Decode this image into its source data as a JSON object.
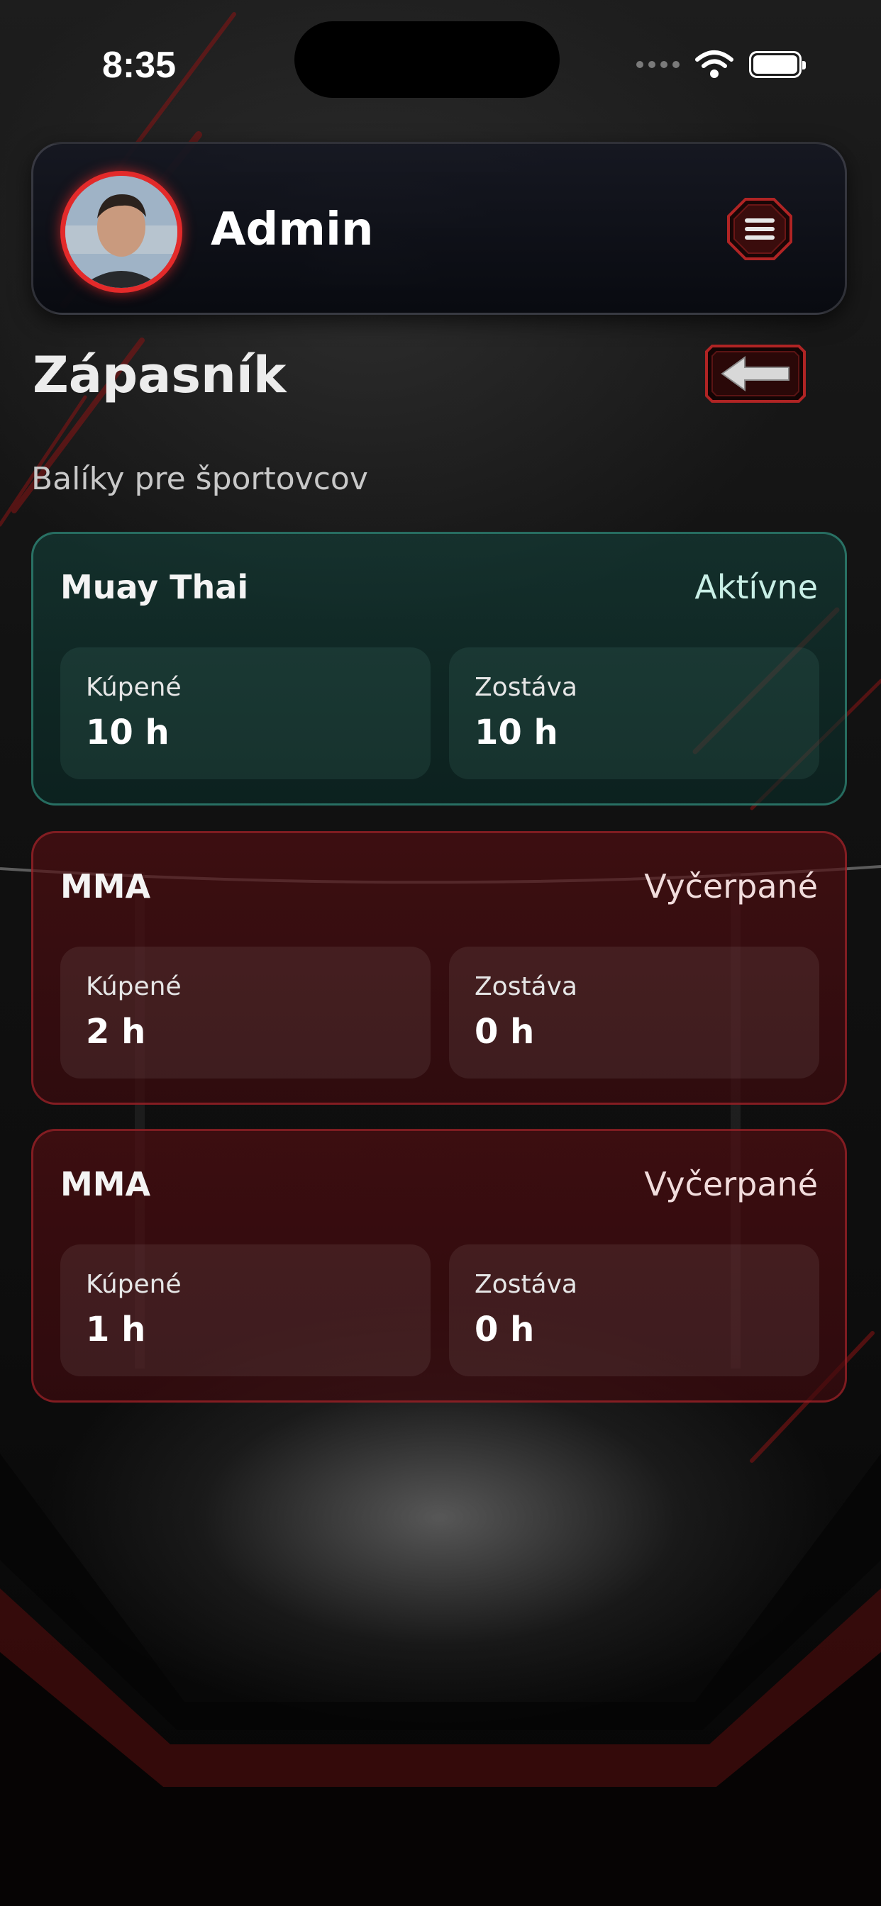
{
  "status_bar": {
    "time": "8:35"
  },
  "header": {
    "username": "Admin"
  },
  "page": {
    "title": "Zápasník",
    "section_label": "Balíky pre športovcov"
  },
  "packages": [
    {
      "name": "Muay Thai",
      "status": "Aktívne",
      "purchased_label": "Kúpené",
      "purchased_value": "10 h",
      "remaining_label": "Zostáva",
      "remaining_value": "10 h"
    },
    {
      "name": "MMA",
      "status": "Vyčerpané",
      "purchased_label": "Kúpené",
      "purchased_value": "2 h",
      "remaining_label": "Zostáva",
      "remaining_value": "0 h"
    },
    {
      "name": "MMA",
      "status": "Vyčerpané",
      "purchased_label": "Kúpené",
      "purchased_value": "1 h",
      "remaining_label": "Zostáva",
      "remaining_value": "0 h"
    }
  ],
  "colors": {
    "accent_red": "#e32a2a",
    "active_teal": "#3caa96",
    "depleted_red": "#b4282e"
  }
}
